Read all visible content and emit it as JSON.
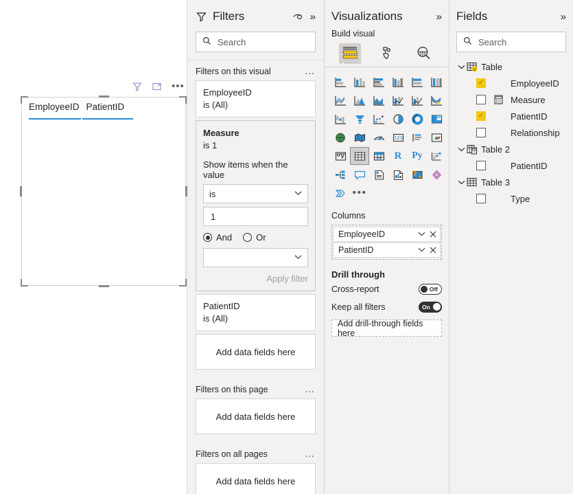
{
  "canvas": {
    "visual_toolbar": [
      {
        "name": "filter-icon",
        "title": "Filters"
      },
      {
        "name": "focus-mode-icon",
        "title": "Focus mode"
      },
      {
        "name": "more-options-icon",
        "title": "More options",
        "glyph": "•••"
      }
    ],
    "table_visual": {
      "columns": [
        "EmployeeID",
        "PatientID"
      ],
      "rows": []
    }
  },
  "filters": {
    "title": "Filters",
    "icons": {
      "filter": "filter-icon",
      "eye": "hide-pane-icon",
      "expand": "»"
    },
    "search": {
      "placeholder": "Search",
      "value": "",
      "icon": "search-icon"
    },
    "sections": [
      {
        "label": "Filters on this visual",
        "more": "…"
      },
      {
        "label": "Filters on this page",
        "more": "…"
      },
      {
        "label": "Filters on all pages",
        "more": "…"
      }
    ],
    "visual_cards": [
      {
        "field": "EmployeeID",
        "summary": "is (All)",
        "expanded": false
      },
      {
        "field": "Measure",
        "summary": "is 1",
        "expanded": true,
        "helper": "Show items when the value",
        "operator": "is",
        "value": "1",
        "conjunction_selected": "And",
        "conjunction_options": [
          "And",
          "Or"
        ],
        "second_operator": "",
        "apply_label": "Apply filter"
      },
      {
        "field": "PatientID",
        "summary": "is (All)",
        "expanded": false
      }
    ],
    "dropzone_label": "Add data fields here"
  },
  "visualizations": {
    "title": "Visualizations",
    "expand_icon": "»",
    "build_label": "Build visual",
    "tabs": [
      {
        "name": "build-visual-tab",
        "icon": "table-fields-icon",
        "active": true
      },
      {
        "name": "format-visual-tab",
        "icon": "paint-roller-icon",
        "active": false
      },
      {
        "name": "analytics-tab",
        "icon": "magnifier-chart-icon",
        "active": false
      }
    ],
    "visual_types": [
      "stacked-bar-chart",
      "stacked-column-chart",
      "clustered-bar-chart",
      "clustered-column-chart",
      "100-stacked-bar-chart",
      "100-stacked-column-chart",
      "line-chart",
      "area-chart",
      "stacked-area-chart",
      "line-and-stacked-column-chart",
      "line-and-clustered-column-chart",
      "ribbon-chart",
      "waterfall-chart",
      "funnel-chart",
      "scatter-chart",
      "pie-chart",
      "donut-chart",
      "treemap",
      "map",
      "filled-map",
      "azure-map",
      "card",
      "multi-row-card",
      "kpi",
      "slicer",
      "table",
      "matrix",
      "r-script-visual",
      "python-visual",
      "key-influencers",
      "decomposition-tree",
      "q-and-a",
      "narrative",
      "paginated-report",
      "arcgis-maps",
      "power-apps",
      "power-automate"
    ],
    "more_label": "•••",
    "wells": [
      {
        "label": "Columns",
        "fields": [
          {
            "name": "EmployeeID"
          },
          {
            "name": "PatientID"
          }
        ]
      }
    ],
    "drill_through": {
      "label": "Drill through",
      "toggles": [
        {
          "label": "Cross-report",
          "state": "Off",
          "on": false
        },
        {
          "label": "Keep all filters",
          "state": "On",
          "on": true
        }
      ],
      "dropzone_label": "Add drill-through fields here"
    }
  },
  "fields": {
    "title": "Fields",
    "expand_icon": "»",
    "search": {
      "placeholder": "Search",
      "value": "",
      "icon": "search-icon"
    },
    "tables": [
      {
        "name": "Table",
        "icon": "table-checked-icon",
        "expanded": true,
        "fields": [
          {
            "name": "EmployeeID",
            "checked": true,
            "icon": null
          },
          {
            "name": "Measure",
            "checked": false,
            "icon": "measure-icon"
          },
          {
            "name": "PatientID",
            "checked": true,
            "icon": null
          },
          {
            "name": "Relationship",
            "checked": false,
            "icon": null
          }
        ]
      },
      {
        "name": "Table 2",
        "icon": "table-measure-icon",
        "expanded": true,
        "fields": [
          {
            "name": "PatientID",
            "checked": false,
            "icon": null
          }
        ]
      },
      {
        "name": "Table 3",
        "icon": "table-icon",
        "expanded": true,
        "fields": [
          {
            "name": "Type",
            "checked": false,
            "icon": null
          }
        ]
      }
    ]
  },
  "colors": {
    "accent_yellow": "#f2c811",
    "accent_blue": "#2a8fd4",
    "pane_bg": "#f3f2f1",
    "border": "#d6d6d6",
    "text": "#252423"
  }
}
